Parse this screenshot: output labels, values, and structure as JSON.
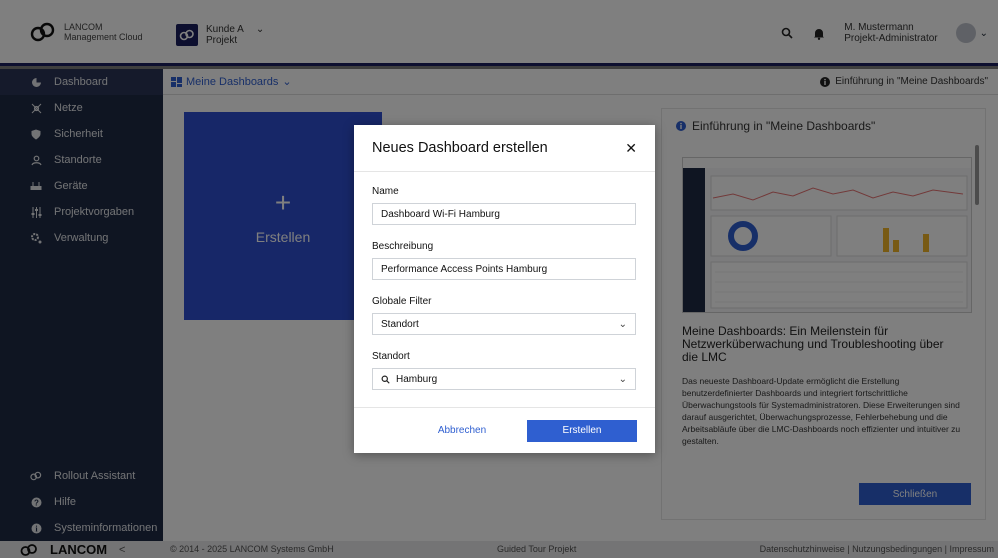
{
  "brand": {
    "line1": "LANCOM",
    "line2": "Management Cloud"
  },
  "project": {
    "customer": "Kunde A",
    "name": "Projekt"
  },
  "user": {
    "name": "M. Mustermann",
    "role": "Projekt-Administrator"
  },
  "sidebar": {
    "items": [
      {
        "label": "Dashboard",
        "icon": "dashboard-icon"
      },
      {
        "label": "Netze",
        "icon": "network-icon"
      },
      {
        "label": "Sicherheit",
        "icon": "shield-icon"
      },
      {
        "label": "Standorte",
        "icon": "location-icon"
      },
      {
        "label": "Geräte",
        "icon": "device-icon"
      },
      {
        "label": "Projektvorgaben",
        "icon": "sliders-icon"
      },
      {
        "label": "Verwaltung",
        "icon": "gear-icon"
      }
    ],
    "bottom": [
      {
        "label": "Rollout Assistant",
        "icon": "rollout-icon"
      },
      {
        "label": "Hilfe",
        "icon": "help-icon"
      },
      {
        "label": "Systeminformationen",
        "icon": "info-icon"
      }
    ]
  },
  "subbar": {
    "crumb": "Meine Dashboards",
    "intro_link": "Einführung in \"Meine Dashboards\""
  },
  "main": {
    "tile_label": "Erstellen"
  },
  "intro_panel": {
    "title": "Einführung in \"Meine Dashboards\"",
    "heading": "Meine Dashboards: Ein Meilenstein für Netzwerküberwachung und Troubleshooting über die LMC",
    "body": "Das neueste Dashboard-Update ermöglicht die Erstellung benutzerdefinierter Dashboards und integriert fortschrittliche Überwachungstools für Systemadministratoren. Diese Erweiterungen sind darauf ausgerichtet, Überwachungsprozesse, Fehlerbehebung und die Arbeitsabläufe über die LMC-Dashboards noch effizienter und intuitiver zu gestalten.",
    "close_label": "Schließen"
  },
  "modal": {
    "title": "Neues Dashboard erstellen",
    "name_label": "Name",
    "name_value": "Dashboard Wi-Fi Hamburg",
    "desc_label": "Beschreibung",
    "desc_value": "Performance Access Points Hamburg",
    "filter_label": "Globale Filter",
    "filter_value": "Standort",
    "location_label": "Standort",
    "location_value": "Hamburg",
    "cancel_label": "Abbrechen",
    "create_label": "Erstellen"
  },
  "footer": {
    "logo": "LANCOM",
    "collapse": "<",
    "copyright": "© 2014 - 2025 LANCOM Systems GmbH",
    "tour": "Guided Tour Projekt",
    "privacy": "Datenschutzhinweise",
    "terms": "Nutzungsbedingungen",
    "imprint": "Impressum"
  },
  "colors": {
    "accent": "#2f5fd0",
    "tile": "#2f4fd1",
    "sidebar": "#1f2a44",
    "navy": "#1a1f5e"
  }
}
